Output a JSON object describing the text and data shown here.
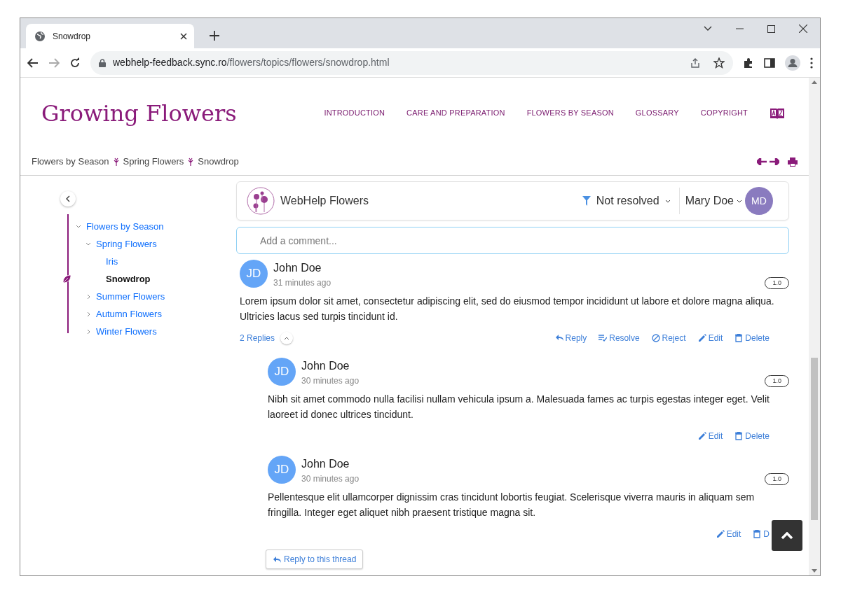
{
  "browser": {
    "tab_title": "Snowdrop",
    "url_host": "webhelp-feedback.sync.ro",
    "url_path": "/flowers/topics/flowers/snowdrop.html"
  },
  "site": {
    "title": "Growing Flowers",
    "nav": [
      "INTRODUCTION",
      "CARE AND PREPARATION",
      "FLOWERS BY SEASON",
      "GLOSSARY",
      "COPYRIGHT"
    ]
  },
  "breadcrumb": [
    "Flowers by Season",
    "Spring Flowers",
    "Snowdrop"
  ],
  "toc": [
    {
      "label": "Flowers by Season",
      "expanded": true,
      "selected": false,
      "children": [
        {
          "label": "Spring Flowers",
          "expanded": true,
          "selected": false,
          "children": [
            {
              "label": "Iris",
              "selected": false
            },
            {
              "label": "Snowdrop",
              "selected": true
            }
          ]
        },
        {
          "label": "Summer Flowers",
          "expanded": false,
          "selected": false
        },
        {
          "label": "Autumn Flowers",
          "expanded": false,
          "selected": false
        },
        {
          "label": "Winter Flowers",
          "expanded": false,
          "selected": false
        }
      ]
    }
  ],
  "feedback": {
    "site_name": "WebHelp Flowers",
    "filter": "Not resolved",
    "user": {
      "name": "Mary Doe",
      "initials": "MD"
    },
    "comment_placeholder": "Add a comment...",
    "comments": [
      {
        "initials": "JD",
        "author": "John Doe",
        "time": "31 minutes ago",
        "version": "1.0",
        "text": "Lorem ipsum dolor sit amet, consectetur adipiscing elit, sed do eiusmod tempor incididunt ut labore et dolore magna aliqua. Ultricies lacus sed turpis tincidunt id.",
        "replies_count": "2 Replies",
        "expanded": true,
        "actions": [
          {
            "kind": "reply",
            "label": "Reply"
          },
          {
            "kind": "resolve",
            "label": "Resolve"
          },
          {
            "kind": "reject",
            "label": "Reject"
          },
          {
            "kind": "edit",
            "label": "Edit"
          },
          {
            "kind": "delete",
            "label": "Delete"
          }
        ],
        "replies": [
          {
            "initials": "JD",
            "author": "John Doe",
            "time": "30 minutes ago",
            "version": "1.0",
            "text": "Nibh sit amet commodo nulla facilisi nullam vehicula ipsum a. Malesuada fames ac turpis egestas integer eget. Velit laoreet id donec ultrices tincidunt.",
            "actions": [
              {
                "kind": "edit",
                "label": "Edit"
              },
              {
                "kind": "delete",
                "label": "Delete"
              }
            ]
          },
          {
            "initials": "JD",
            "author": "John Doe",
            "time": "30 minutes ago",
            "version": "1.0",
            "text": "Pellentesque elit ullamcorper dignissim cras tincidunt lobortis feugiat. Scelerisque viverra mauris in aliquam sem fringilla. Integer eget aliquet nibh praesent tristique magna sit.",
            "actions": [
              {
                "kind": "edit",
                "label": "Edit"
              },
              {
                "kind": "delete",
                "label": "D"
              }
            ]
          }
        ],
        "reply_thread": "Reply to this thread"
      }
    ]
  }
}
